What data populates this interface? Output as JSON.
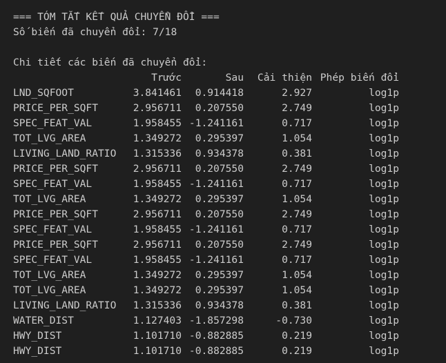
{
  "summary": {
    "header": "=== TÓM TẮT KẾT QUẢ CHUYỂN ĐỔI ===",
    "count_line": "Số biến đã chuyển đổi: 7/18",
    "details_title": "Chi tiết các biến đã chuyển đổi:"
  },
  "table": {
    "columns": [
      "",
      "Trước",
      "Sau",
      "Cải thiện",
      "Phép biến đổi"
    ],
    "rows": [
      [
        "LND_SQFOOT",
        "3.841461",
        "0.914418",
        "2.927",
        "log1p"
      ],
      [
        "PRICE_PER_SQFT",
        "2.956711",
        "0.207550",
        "2.749",
        "log1p"
      ],
      [
        "SPEC_FEAT_VAL",
        "1.958455",
        "-1.241161",
        "0.717",
        "log1p"
      ],
      [
        "TOT_LVG_AREA",
        "1.349272",
        "0.295397",
        "1.054",
        "log1p"
      ],
      [
        "LIVING_LAND_RATIO",
        "1.315336",
        "0.934378",
        "0.381",
        "log1p"
      ],
      [
        "PRICE_PER_SQFT",
        "2.956711",
        "0.207550",
        "2.749",
        "log1p"
      ],
      [
        "SPEC_FEAT_VAL",
        "1.958455",
        "-1.241161",
        "0.717",
        "log1p"
      ],
      [
        "TOT_LVG_AREA",
        "1.349272",
        "0.295397",
        "1.054",
        "log1p"
      ],
      [
        "PRICE_PER_SQFT",
        "2.956711",
        "0.207550",
        "2.749",
        "log1p"
      ],
      [
        "SPEC_FEAT_VAL",
        "1.958455",
        "-1.241161",
        "0.717",
        "log1p"
      ],
      [
        "PRICE_PER_SQFT",
        "2.956711",
        "0.207550",
        "2.749",
        "log1p"
      ],
      [
        "SPEC_FEAT_VAL",
        "1.958455",
        "-1.241161",
        "0.717",
        "log1p"
      ],
      [
        "TOT_LVG_AREA",
        "1.349272",
        "0.295397",
        "1.054",
        "log1p"
      ],
      [
        "TOT_LVG_AREA",
        "1.349272",
        "0.295397",
        "1.054",
        "log1p"
      ],
      [
        "LIVING_LAND_RATIO",
        "1.315336",
        "0.934378",
        "0.381",
        "log1p"
      ],
      [
        "WATER_DIST",
        "1.127403",
        "-1.857298",
        "-0.730",
        "log1p"
      ],
      [
        "HWY_DIST",
        "1.101710",
        "-0.882885",
        "0.219",
        "log1p"
      ],
      [
        "HWY_DIST",
        "1.101710",
        "-0.882885",
        "0.219",
        "log1p"
      ]
    ]
  },
  "colors": {
    "background": "#1f1f1f",
    "text": "#cccccc"
  }
}
